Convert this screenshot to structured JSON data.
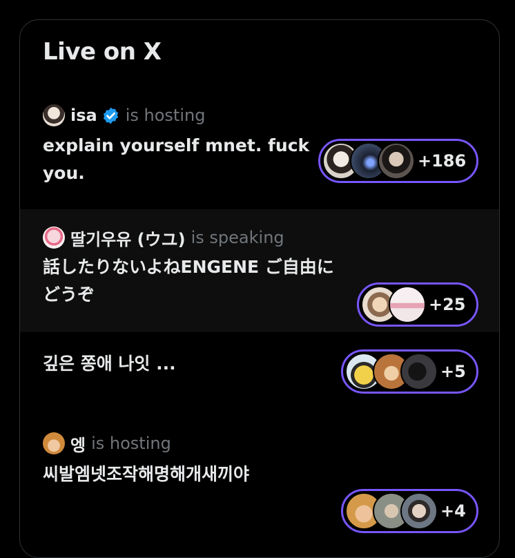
{
  "widget": {
    "title": "Live on X"
  },
  "spaces": [
    {
      "host_name": "isa",
      "host_role": "is hosting",
      "verified": true,
      "title": "explain yourself mnet. fuck you.",
      "listener_count": "+186",
      "avatar_colors": [
        "#d8d2c9",
        "#3b4a66",
        "#5c5450"
      ]
    },
    {
      "host_name": "딸기우유 (ウユ)",
      "host_role": "is speaking",
      "verified": false,
      "title": "話したりないよねENGENE ご自由にどうぞ",
      "listener_count": "+25",
      "avatar_colors": [
        "#e9ddcf",
        "#f1e6e8"
      ]
    },
    {
      "host_name": "",
      "host_role": "",
      "verified": false,
      "title": "깊은 쫑애 나잇 ...",
      "listener_count": "+5",
      "avatar_colors": [
        "#f2d14a",
        "#b9743c",
        "#3a3a3e"
      ]
    },
    {
      "host_name": "엥",
      "host_role": "is hosting",
      "verified": false,
      "title": "씨발엠넷조작해명해개새끼야",
      "listener_count": "+4",
      "avatar_colors": [
        "#d49a4a",
        "#8a8f86",
        "#6d7784"
      ]
    }
  ],
  "colors": {
    "accent": "#7856ff",
    "verified": "#1d9bf0",
    "muted": "#71767b"
  }
}
